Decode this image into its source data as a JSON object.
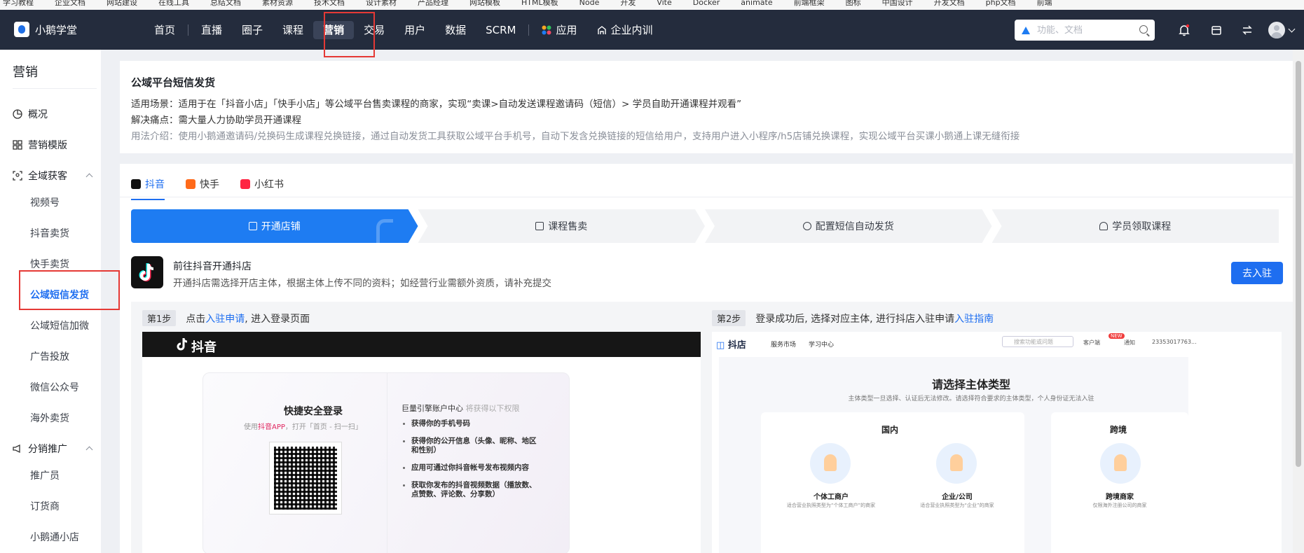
{
  "bookmarks": [
    "学习教程",
    "企业文档",
    "网站建设",
    "在线工具",
    "总结文档",
    "素材资源",
    "技术文档",
    "设计素材",
    "产品经理",
    "网站模板",
    "HTML模板",
    "Node",
    "开发",
    "Vite",
    "Docker",
    "animate",
    "前端框架",
    "图标",
    "中国设计",
    "开发文档",
    "php文档",
    "前端"
  ],
  "app": {
    "name": "小鹅学堂"
  },
  "nav": {
    "items": [
      "首页",
      "直播",
      "圈子",
      "课程",
      "营销",
      "交易",
      "用户",
      "数据",
      "SCRM",
      "应用",
      "企业内训"
    ],
    "active": "营销"
  },
  "search": {
    "placeholder": "功能、文档"
  },
  "colors": {
    "nav_bg": "#242c3d",
    "accent": "#1e6ef0",
    "highlight_box": "#e53935"
  },
  "sidebar": {
    "title": "营销",
    "groups": [
      {
        "label": "概况",
        "icon": "pie-chart-icon"
      },
      {
        "label": "营销模版",
        "icon": "grid-icon"
      },
      {
        "label": "全域获客",
        "icon": "scan-user-icon",
        "expanded": true,
        "items": [
          "视频号",
          "抖音卖货",
          "快手卖货",
          "公域短信发货",
          "公域短信加微",
          "广告投放",
          "微信公众号",
          "海外卖货"
        ],
        "active": "公域短信发货"
      },
      {
        "label": "分销推广",
        "icon": "megaphone-icon",
        "expanded": true,
        "items": [
          "推广员",
          "订货商",
          "小鹅通小店"
        ]
      }
    ]
  },
  "info": {
    "title": "公域平台短信发货",
    "scene": "适用场景：适用于在「抖音小店」「快手小店」等公域平台售卖课程的商家，实现“卖课>自动发送课程邀请码（短信）> 学员自助开通课程并观看”",
    "pain": "解决痛点：需大量人力协助学员开通课程",
    "usage": "用法介绍：使用小鹅通邀请码/兑换码生成课程兑换链接，通过自动发货工具获取公域平台手机号，自动下发含兑换链接的短信给用户，支持用户进入小程序/h5店铺兑换课程，实现公域平台买课小鹅通上课无缝衔接"
  },
  "tabs": [
    {
      "label": "抖音",
      "active": true
    },
    {
      "label": "快手",
      "active": false
    },
    {
      "label": "小红书",
      "active": false
    }
  ],
  "steps": [
    "开通店铺",
    "课程售卖",
    "配置短信自动发货",
    "学员领取课程"
  ],
  "shop": {
    "title": "前往抖音开通抖店",
    "desc": "开通抖店需选择开店主体，根据主体上传不同的资料；如经营行业需额外资质，请补充提交",
    "button": "去入驻"
  },
  "guide": {
    "step1": {
      "badge": "第1步",
      "pre": "点击",
      "link": "入驻申请",
      "post": ", 进入登录页面"
    },
    "step2": {
      "badge": "第2步",
      "pre": "登录成功后, 选择对应主体, 进行抖店入驻申请 ",
      "link": "入驻指南"
    }
  },
  "shot1": {
    "brand": "抖音",
    "login_title": "快捷安全登录",
    "login_sub_pre": "使用",
    "login_sub_app": "抖音APP",
    "login_sub_post": "，打开「首页 - 扫一扫」",
    "rights_title": "巨量引擎账户中心",
    "rights_sub": "将获得以下权限",
    "rights": [
      "获得你的手机号码",
      "获得你的公开信息（头像、昵称、地区和性别）",
      "应用可通过你抖音帐号发布视频内容",
      "获取你发布的抖音视频数据（播放数、点赞数、评论数、分享数）"
    ]
  },
  "shot2": {
    "brand": "抖店",
    "menu": [
      "服务市场",
      "学习中心"
    ],
    "search_placeholder": "搜索功能或问题",
    "top_right": [
      "客户端",
      "通知",
      "23353017763..."
    ],
    "new_badge": "NEW",
    "title": "请选择主体类型",
    "subtitle": "主体类型一旦选择、认证后无法修改。请选择符合要求的主体类型，个人身份证无法入驻",
    "domestic": "国内",
    "cross": "跨境",
    "cards": [
      {
        "title": "个体工商户",
        "desc": "适合营业执照类型为“个体工商户”的商家"
      },
      {
        "title": "企业/公司",
        "desc": "适合营业执照类型为“企业”的商家"
      },
      {
        "title": "跨境商家",
        "desc": "仅限海外注册公司的商家"
      }
    ]
  }
}
